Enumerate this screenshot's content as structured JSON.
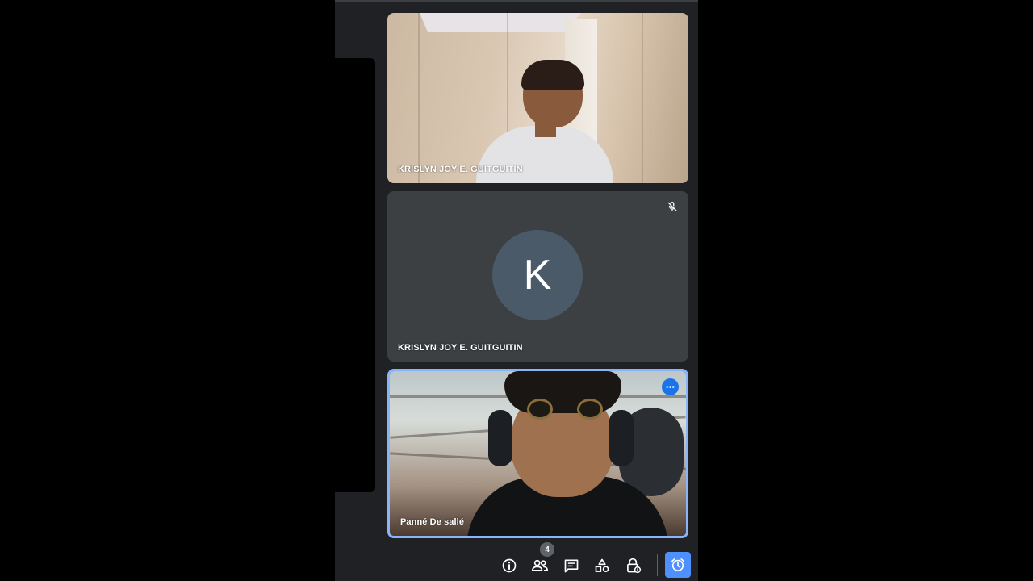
{
  "colors": {
    "panel_bg": "#202124",
    "tile_bg": "#3c4043",
    "avatar_bg": "#4a5a68",
    "active_border": "#8ab4f8",
    "accent_blue": "#1a73e8",
    "alarm_blue": "#4d90fe",
    "icon_white": "#ffffff"
  },
  "tiles": [
    {
      "name": "KRISLYN JOY E. GUITGUITIN",
      "video_on": true
    },
    {
      "name": "KRISLYN JOY E. GUITGUITIN",
      "video_on": false,
      "avatar_initial": "K",
      "muted": true,
      "status_icon": "mic-off-icon"
    },
    {
      "name": "Panné De sallé",
      "video_on": true,
      "active_speaker": true,
      "menu_icon": "more-horiz-icon"
    }
  ],
  "toolbar": {
    "people_count": "4",
    "icons": [
      "info-icon",
      "people-icon",
      "chat-icon",
      "activities-icon",
      "host-controls-icon",
      "alarm-icon"
    ]
  }
}
